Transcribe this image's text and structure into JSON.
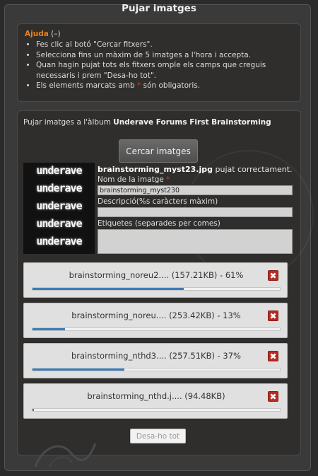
{
  "title": "Pujar imatges",
  "help": {
    "heading": "Ajuda",
    "toggle": "(–)",
    "items": [
      "Fes clic al botó \"Cercar fitxers\".",
      "Selecciona fins un màxim de 5 imatges a l'hora i accepta.",
      "Quan hagin pujat tots els fitxers omple els camps que creguis necessaris i prem \"Desa-ho tot\".",
      "Els elements marcats amb",
      "són obligatoris."
    ],
    "required_mark": "*"
  },
  "upload": {
    "intro": "Pujar imatges a l'àlbum",
    "album": "Underave Forums First Brainstorming",
    "browse_label": "Cercar imatges",
    "done_file": "brainstorming_myst23.jpg",
    "done_text": "pujat correctament.",
    "thumb_text": "underave",
    "name_label": "Nom de la imatge",
    "name_value": "brainstorming_myst230",
    "desc_label": "Descripció(%s caràcters màxim)",
    "desc_value": "",
    "tags_label": "Etiquetes (separades per comes)",
    "tags_value": "",
    "queue": [
      {
        "name": "brainstorming_noreu2.... (157.21KB) - 61%",
        "progress": 0.61
      },
      {
        "name": "brainstorming_noreu.... (253.42KB) - 13%",
        "progress": 0.13
      },
      {
        "name": "brainstorming_nthd3.... (257.51KB) - 37%",
        "progress": 0.37
      },
      {
        "name": "brainstorming_nthd.j.... (94.48KB)",
        "progress": 0.0
      }
    ],
    "remove_glyph": "✖",
    "save_all_label": "Desa-ho tot"
  }
}
